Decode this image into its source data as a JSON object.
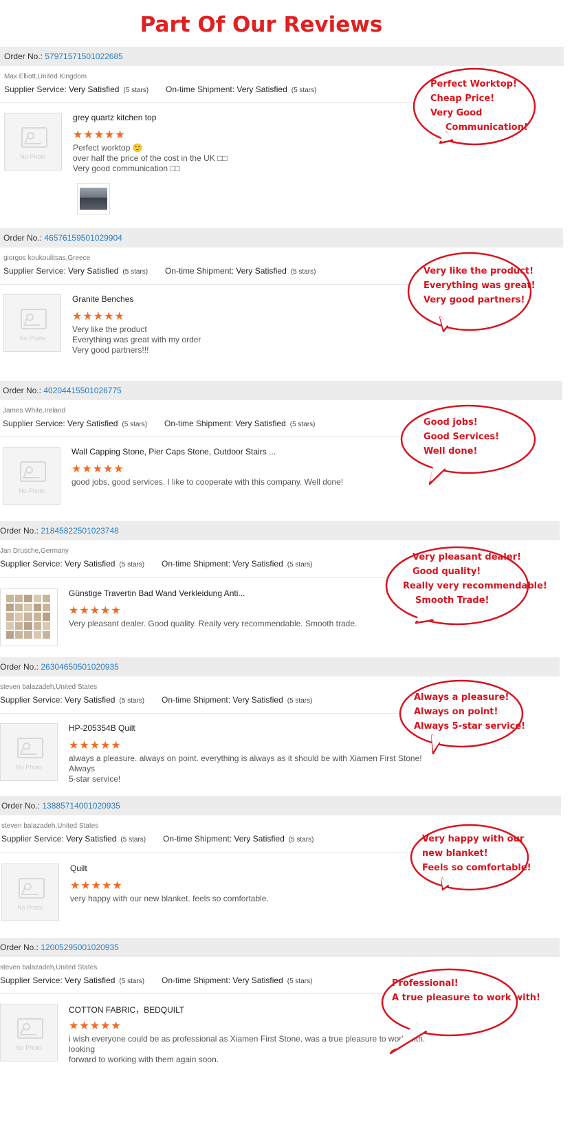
{
  "title": "Part Of Our Reviews",
  "labels": {
    "order_no": "Order No.:",
    "supplier_service": "Supplier Service:",
    "ontime_shipment": "On-time Shipment:",
    "no_photo": "No Photo"
  },
  "reviews": [
    {
      "order_no": "57971571501022685",
      "buyer": "Max Elliott,United Kingdom",
      "supplier_value": "Very Satisfied",
      "supplier_stars": "(5 stars)",
      "shipment_value": "Very Satisfied",
      "shipment_stars": "(5 stars)",
      "product": "grey quartz kitchen top",
      "stars": "★★★★★",
      "comment": [
        "Perfect worktop 🙂",
        "over half the price of the cost in the UK □□",
        "Very good communication □□"
      ],
      "bubble": [
        "Perfect Worktop!",
        "Cheap Price!",
        "Very Good",
        "Communication!"
      ]
    },
    {
      "order_no": "46576159501029904",
      "buyer": "giorgos koukoulitsas,Greece",
      "supplier_value": "Very Satisfied",
      "supplier_stars": "(5 stars)",
      "shipment_value": "Very Satisfied",
      "shipment_stars": "(5 stars)",
      "product": "Granite Benches",
      "stars": "★★★★★",
      "comment": [
        "Very like the product",
        "Everything was great with my order",
        "Very good partners!!!"
      ],
      "bubble": [
        "Very like the product!",
        "Everything was great!",
        "Very good partners!"
      ]
    },
    {
      "order_no": "40204415501026775",
      "buyer": "James White,Ireland",
      "supplier_value": "Very Satisfied",
      "supplier_stars": "(5 stars)",
      "shipment_value": "Very Satisfied",
      "shipment_stars": "(5 stars)",
      "product": "Wall Capping Stone, Pier Caps Stone, Outdoor Stairs ...",
      "stars": "★★★★★",
      "comment": [
        "good jobs, good services. I like to cooperate with this company. Well done!"
      ],
      "bubble": [
        "Good jobs!",
        "Good Services!",
        "Well done!"
      ]
    },
    {
      "order_no": "21845822501023748",
      "buyer": "Jan Drusche,Germany",
      "supplier_value": "Very Satisfied",
      "supplier_stars": "(5 stars)",
      "shipment_value": "Very Satisfied",
      "shipment_stars": "(5 stars)",
      "product": "Günstige Travertin Bad Wand Verkleidung Anti...",
      "stars": "★★★★★",
      "comment": [
        "Very pleasant dealer. Good quality. Really very recommendable. Smooth trade."
      ],
      "bubble": [
        "Very pleasant dealer!",
        "Good quality!",
        "Really very recommendable!",
        "Smooth Trade!"
      ]
    },
    {
      "order_no": "26304650501020935",
      "buyer": "steven balazadeh,United States",
      "supplier_value": "Very Satisfied",
      "supplier_stars": "(5 stars)",
      "shipment_value": "Very Satisfied",
      "shipment_stars": "(5 stars)",
      "product": "HP-205354B Quilt",
      "stars": "★★★★★",
      "comment": [
        "always a pleasure.  always on point.  everything is always as it should be with Xiamen First Stone!  Always",
        "5-star service!"
      ],
      "bubble": [
        "Always a pleasure!",
        "Always on point!",
        "Always 5-star service!"
      ]
    },
    {
      "order_no": "13885714001020935",
      "buyer": "steven balazadeh,United States",
      "supplier_value": "Very Satisfied",
      "supplier_stars": "(5 stars)",
      "shipment_value": "Very Satisfied",
      "shipment_stars": "(5 stars)",
      "product": "Quilt",
      "stars": "★★★★★",
      "comment": [
        "very happy with our new blanket.  feels so comfortable."
      ],
      "bubble": [
        "Very happy with our",
        "new blanket!",
        "Feels so comfortable!"
      ]
    },
    {
      "order_no": "12005295001020935",
      "buyer": "steven balazadeh,United States",
      "supplier_value": "Very Satisfied",
      "supplier_stars": "(5 stars)",
      "shipment_value": "Very Satisfied",
      "shipment_stars": "(5 stars)",
      "product": "COTTON FABRIC，BEDQUILT",
      "stars": "★★★★★",
      "comment": [
        "i wish everyone could be as professional as Xiamen First Stone.  was a true pleasure to work with.  looking",
        "forward to working with them again soon."
      ],
      "bubble": [
        "Professional!",
        "A true pleasure to work with!"
      ]
    }
  ],
  "colors": {
    "title": "#e02020",
    "order_link": "#2a7cc0",
    "stars": "#f26a21",
    "bubble": "#d8141e"
  }
}
